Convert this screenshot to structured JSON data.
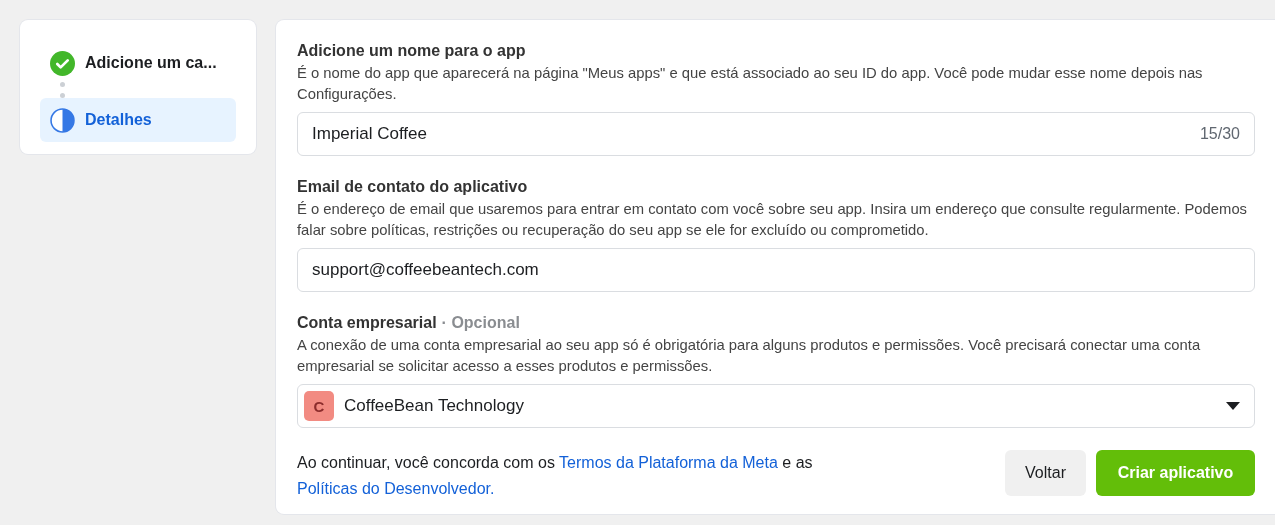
{
  "steps": [
    {
      "label": "Adicione um ca...",
      "completed": true,
      "selected": false
    },
    {
      "label": "Detalhes",
      "completed": false,
      "selected": true
    }
  ],
  "sections": [
    {
      "title": "Adicione um nome para o app",
      "description": "É o nome do app que aparecerá na página \"Meus apps\" e que está associado ao seu ID do app. Você pode mudar esse nome depois nas Configurações.",
      "field": {
        "kind": "text",
        "value": "Imperial Coffee",
        "counter": "15/30"
      }
    },
    {
      "title": "Email de contato do aplicativo",
      "description": "É o endereço de email que usaremos para entrar em contato com você sobre seu app. Insira um endereço que consulte regularmente. Podemos falar sobre políticas, restrições ou recuperação do seu app se ele for excluído ou comprometido.",
      "field": {
        "kind": "text",
        "value": "support@coffeebeantech.com"
      }
    },
    {
      "title": "Conta empresarial",
      "optional": "· Opcional",
      "description": "A conexão de uma conta empresarial ao seu app só é obrigatória para alguns produtos e permissões. Você precisará conectar uma conta empresarial se solicitar acesso a esses produtos e permissões.",
      "field": {
        "kind": "select",
        "value": "CoffeeBean Technology",
        "avatar": "C",
        "color": "#f28b82"
      }
    }
  ],
  "footer": {
    "parts": [
      {
        "kind": "text",
        "text": "Ao continuar, você concorda com os "
      },
      {
        "kind": "link",
        "text": "Termos da Plataforma da Meta"
      },
      {
        "kind": "text",
        "text": " e as "
      },
      {
        "kind": "link",
        "text": "Políticas do Desenvolvedor."
      }
    ],
    "buttons": [
      {
        "label": "Voltar",
        "kind": "secondary"
      },
      {
        "label": "Criar aplicativo",
        "kind": "primary"
      }
    ]
  }
}
